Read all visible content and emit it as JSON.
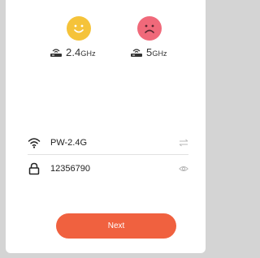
{
  "bands": {
    "band24": {
      "main": "2.4",
      "unit": "GHz",
      "status": "happy",
      "face_icon": "smiley-face-icon",
      "router_icon": "router-icon"
    },
    "band5": {
      "main": "5",
      "unit": "GHz",
      "status": "sad",
      "face_icon": "sad-face-icon",
      "router_icon": "router-icon"
    }
  },
  "wifi": {
    "ssid": "PW-2.4G",
    "lead_icon": "wifi-icon",
    "trail_icon": "switch-arrows-icon"
  },
  "password": {
    "value": "12356790",
    "lead_icon": "lock-icon",
    "trail_icon": "eye-icon"
  },
  "next_button": {
    "label": "Next"
  },
  "colors": {
    "accent": "#f0613f",
    "happy": "#f5c33a",
    "sad": "#f0697a"
  }
}
